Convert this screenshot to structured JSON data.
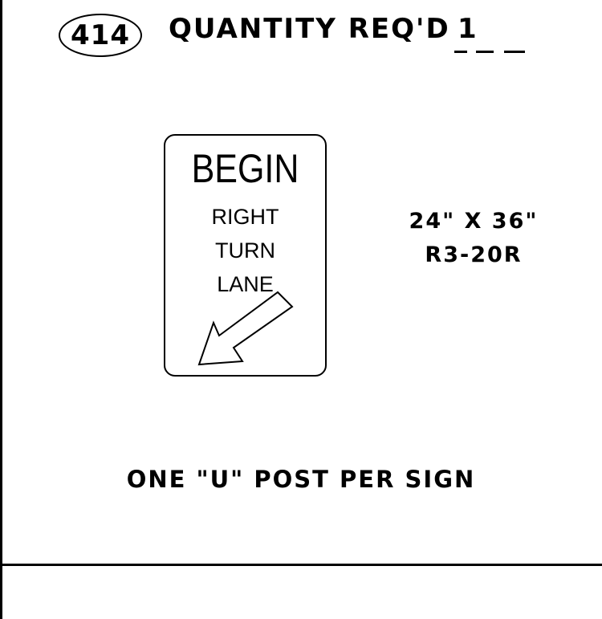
{
  "header": {
    "item_number": "414",
    "quantity_label": "QUANTITY REQ'D",
    "quantity_value": "1"
  },
  "sign": {
    "title": "BEGIN",
    "lines": [
      "RIGHT",
      "TURN",
      "LANE"
    ],
    "arrow_icon": "arrow-down-left-icon"
  },
  "spec": {
    "size": "24\" X 36\"",
    "code": "R3-20R"
  },
  "note": "ONE \"U\" POST PER SIGN",
  "colors": {
    "ink": "#000000",
    "background": "#ffffff"
  }
}
